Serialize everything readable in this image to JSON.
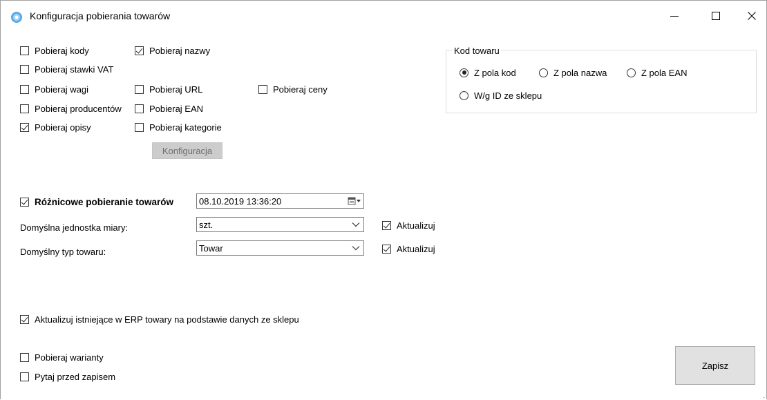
{
  "window": {
    "title": "Konfiguracja pobierania towarów"
  },
  "options": {
    "kody": {
      "label": "Pobieraj kody",
      "checked": false
    },
    "nazwy": {
      "label": "Pobieraj nazwy",
      "checked": true
    },
    "vat": {
      "label": "Pobieraj stawki VAT",
      "checked": false
    },
    "wagi": {
      "label": "Pobieraj wagi",
      "checked": false
    },
    "url": {
      "label": "Pobieraj URL",
      "checked": false
    },
    "ceny": {
      "label": "Pobieraj ceny",
      "checked": false
    },
    "producenci": {
      "label": "Pobieraj producentów",
      "checked": false
    },
    "ean": {
      "label": "Pobieraj EAN",
      "checked": false
    },
    "opisy": {
      "label": "Pobieraj opisy",
      "checked": true
    },
    "kategorie": {
      "label": "Pobieraj kategorie",
      "checked": false
    },
    "config_button": "Konfiguracja"
  },
  "kod_towaru": {
    "legend": "Kod towaru",
    "options": [
      {
        "label": "Z pola kod",
        "checked": true
      },
      {
        "label": "Z pola nazwa",
        "checked": false
      },
      {
        "label": "Z pola EAN",
        "checked": false
      },
      {
        "label": "W/g ID ze sklepu",
        "checked": false
      }
    ]
  },
  "roznicowe": {
    "label": "Różnicowe pobieranie towarów",
    "checked": true,
    "date": "08.10.2019 13:36:20"
  },
  "jednostka": {
    "label": "Domyślna jednostka miary:",
    "value": "szt.",
    "update_label": "Aktualizuj",
    "update_checked": true
  },
  "typ": {
    "label": "Domyślny typ towaru:",
    "value": "Towar",
    "update_label": "Aktualizuj",
    "update_checked": true
  },
  "aktualizuj_erp": {
    "label": "Aktualizuj istniejące w ERP towary na podstawie danych ze sklepu",
    "checked": true
  },
  "warianty": {
    "label": "Pobieraj warianty",
    "checked": false
  },
  "pytaj": {
    "label": "Pytaj przed zapisem",
    "checked": false
  },
  "save_button": "Zapisz"
}
